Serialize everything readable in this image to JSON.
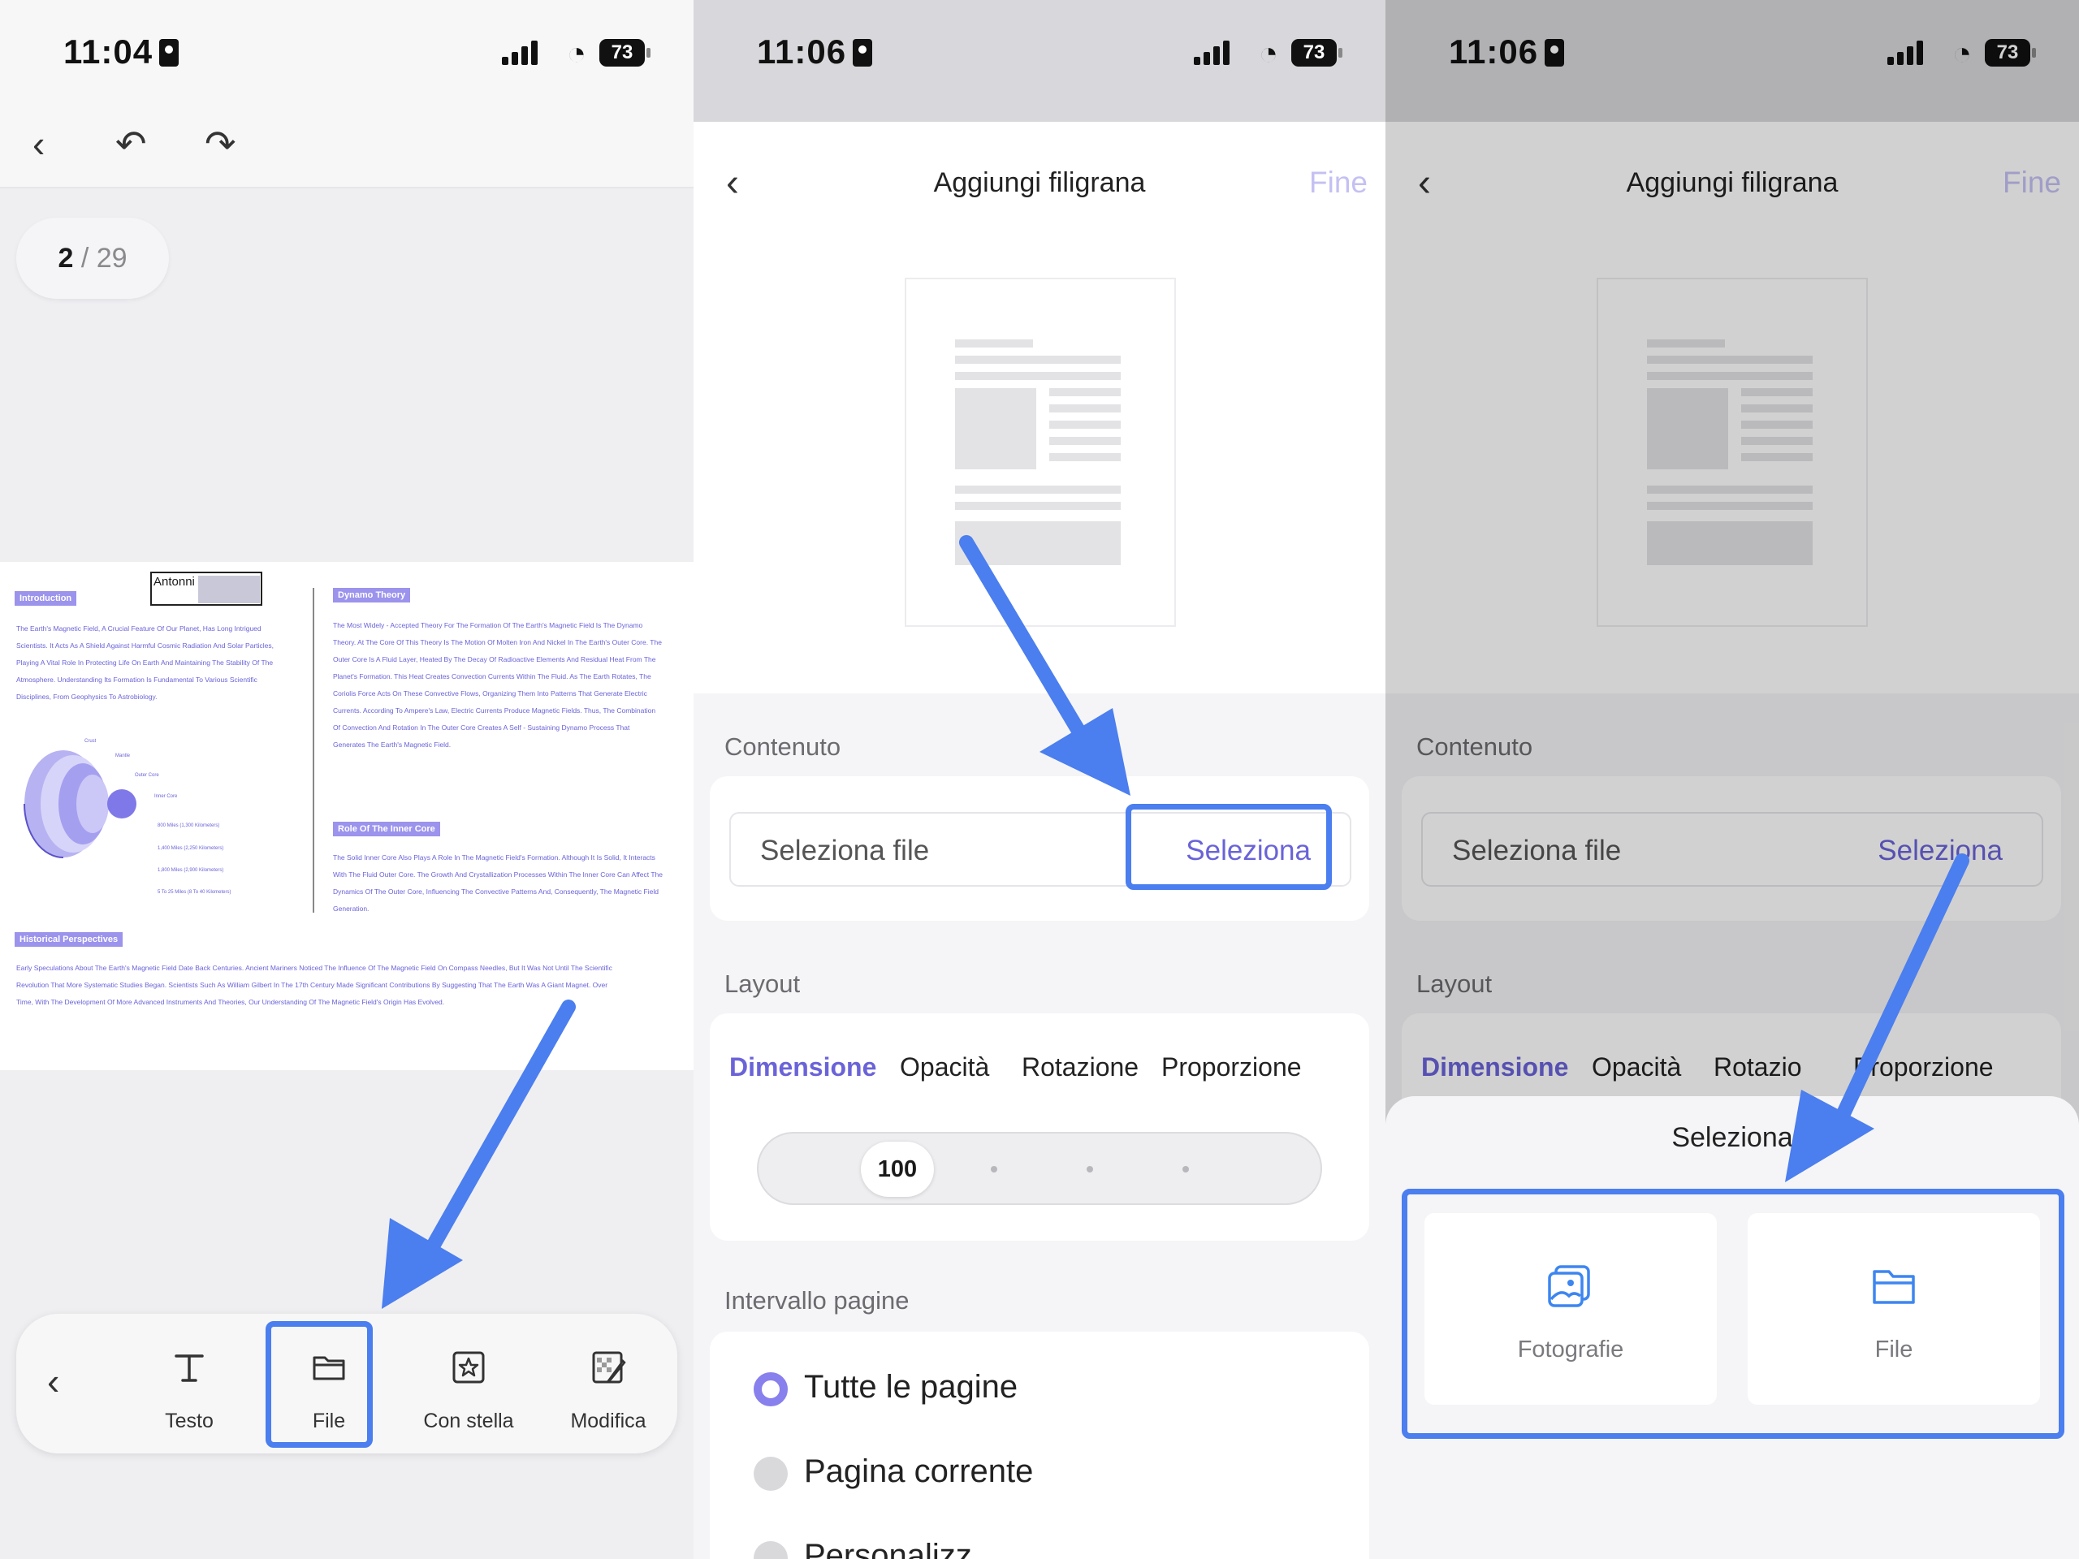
{
  "panel1": {
    "status": {
      "time": "11:04",
      "battery": "73"
    },
    "page_indicator": {
      "current": "2",
      "sep": " / ",
      "total": "29"
    },
    "document": {
      "signature_text": "Antonni o",
      "sections": {
        "introduction": "Introduction",
        "dynamo": "Dynamo Theory",
        "inner_core": "Role Of The Inner Core",
        "historical": "Historical Perspectives"
      },
      "intro_text": "The Earth's Magnetic Field, A Crucial Feature Of Our Planet, Has Long Intrigued Scientists. It Acts As A Shield Against Harmful Cosmic Radiation And Solar Particles, Playing A Vital Role In Protecting Life On Earth And Maintaining The Stability Of The Atmosphere. Understanding Its Formation Is Fundamental To Various Scientific Disciplines, From Geophysics To Astrobiology.",
      "dynamo_text": "The Most Widely - Accepted Theory For The Formation Of The Earth's Magnetic Field Is The Dynamo Theory. At The Core Of This Theory Is The Motion Of Molten Iron And Nickel In The Earth's Outer Core. The Outer Core Is A Fluid Layer, Heated By The Decay Of Radioactive Elements And Residual Heat From The Planet's Formation. This Heat Creates Convection Currents Within The Fluid. As The Earth Rotates, The Coriolis Force Acts On These Convective Flows, Organizing Them Into Patterns That Generate Electric Currents. According To Ampere's Law, Electric Currents Produce Magnetic Fields. Thus, The Combination Of Convection And Rotation In The Outer Core Creates A Self - Sustaining Dynamo Process That Generates The Earth's Magnetic Field.",
      "inner_core_text": "The Solid Inner Core Also Plays A Role In The Magnetic Field's Formation. Although It Is Solid, It Interacts With The Fluid Outer Core. The Growth And Crystallization Processes Within The Inner Core Can Affect The Dynamics Of The Outer Core, Influencing The Convective Patterns And, Consequently, The Magnetic Field Generation.",
      "historical_text": "Early Speculations About The Earth's Magnetic Field Date Back Centuries. Ancient Mariners Noticed The Influence Of The Magnetic Field On Compass Needles, But It Was Not Until The Scientific Revolution That More Systematic Studies Began. Scientists Such As William Gilbert In The 17th Century Made Significant Contributions By Suggesting That The Earth Was A Giant Magnet. Over Time, With The Development Of More Advanced Instruments And Theories, Our Understanding Of The Magnetic Field's Origin Has Evolved.",
      "earth_labels": {
        "crust": "Crust",
        "mantle": "Mantle",
        "outer_core": "Outer Core",
        "inner_core": "Inner Core",
        "d1": "800 Miles (1,300 Kilometers)",
        "d2": "1,400 Miles (2,250 Kilometers)",
        "d3": "1,800 Miles (2,900 Kilometers)",
        "d4": "5 To 25 Miles (8 To 40 Kilometers)"
      }
    },
    "toolbar": {
      "items": [
        {
          "label": "Testo",
          "icon": "text-icon"
        },
        {
          "label": "File",
          "icon": "folder-icon",
          "highlighted": true
        },
        {
          "label": "Con stella",
          "icon": "star-stamp-icon"
        },
        {
          "label": "Modifica",
          "icon": "edit-pattern-icon"
        }
      ]
    }
  },
  "panel2": {
    "status": {
      "time": "11:06",
      "battery": "73"
    },
    "header": {
      "title": "Aggiungi filigrana",
      "done": "Fine"
    },
    "content": {
      "label": "Contenuto",
      "placeholder": "Seleziona file",
      "select_button": "Seleziona"
    },
    "layout": {
      "label": "Layout",
      "tabs": [
        "Dimensione",
        "Opacità",
        "Rotazione",
        "Proporzione"
      ],
      "active_tab": "Dimensione",
      "slider_value": "100"
    },
    "page_range": {
      "label": "Intervallo pagine",
      "options": [
        "Tutte le pagine",
        "Pagina corrente",
        "Personalizz"
      ],
      "selected": "Tutte le pagine"
    }
  },
  "panel3": {
    "status": {
      "time": "11:06",
      "battery": "73"
    },
    "header": {
      "title": "Aggiungi filigrana",
      "done": "Fine"
    },
    "content": {
      "label": "Contenuto",
      "placeholder": "Seleziona file",
      "select_button": "Seleziona"
    },
    "layout": {
      "label": "Layout",
      "tabs": [
        "Dimensione",
        "Opacità",
        "Rotazio",
        "Proporzione"
      ]
    },
    "sheet": {
      "title": "Seleziona",
      "options": [
        {
          "label": "Fotografie",
          "icon": "photos-icon"
        },
        {
          "label": "File",
          "icon": "folder-icon"
        }
      ]
    }
  },
  "colors": {
    "accent": "#6a63d8",
    "highlight": "#4b7eee",
    "done_disabled": "#c4c0f3"
  }
}
